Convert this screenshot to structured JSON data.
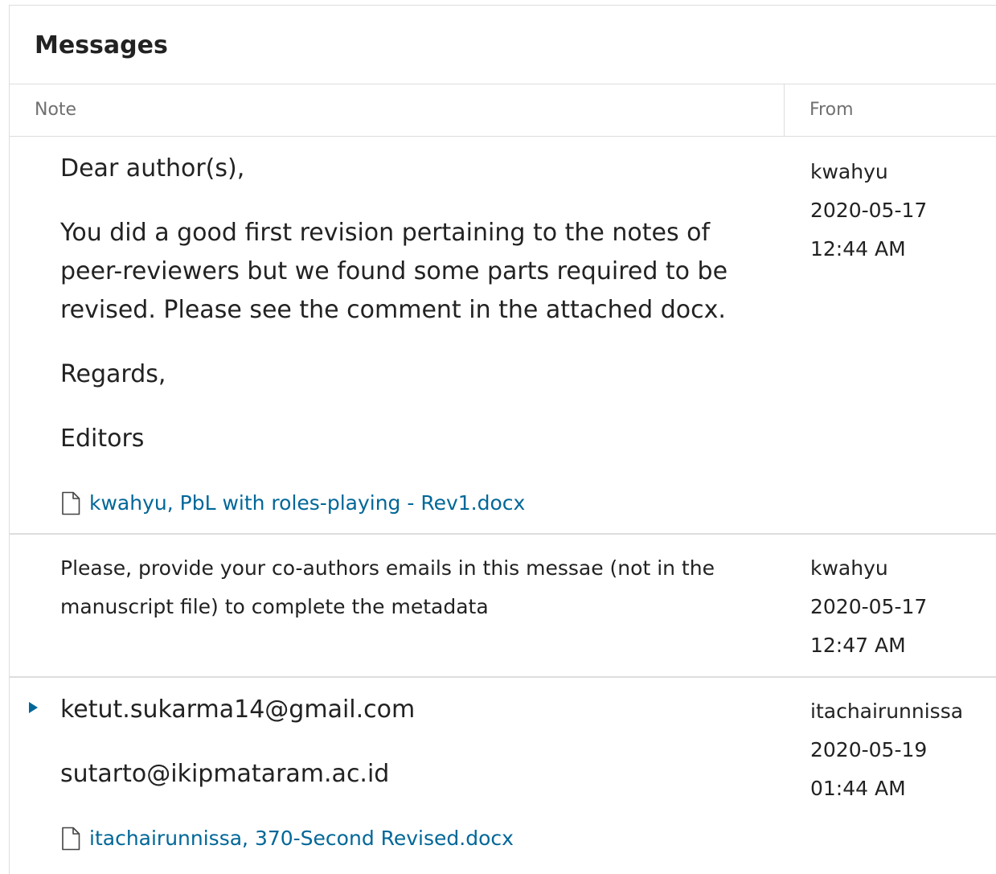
{
  "panel": {
    "title": "Messages"
  },
  "columns": {
    "note": "Note",
    "from": "From"
  },
  "messages": [
    {
      "paragraphs": [
        "Dear author(s),",
        "You did a good first revision pertaining to the notes of peer-reviewers but we found some parts required to be revised. Please see the comment in the attached docx.",
        "Regards,",
        "Editors"
      ],
      "attachment": "kwahyu, PbL with roles-playing - Rev1.docx",
      "from_user": "kwahyu",
      "date": "2020-05-17",
      "time": "12:44 AM"
    },
    {
      "paragraphs": [
        "Please, provide your co-authors emails in this messae (not in the manuscript file) to complete the metadata"
      ],
      "from_user": "kwahyu",
      "date": "2020-05-17",
      "time": "12:47 AM"
    },
    {
      "paragraphs": [
        "ketut.sukarma14@gmail.com",
        "sutarto@ikipmataram.ac.id"
      ],
      "attachment": "itachairunnissa, 370-Second Revised.docx",
      "from_user": "itachairunnissa",
      "date": "2020-05-19",
      "time": "01:44 AM"
    }
  ],
  "icons": {
    "file": "file-icon",
    "expand": "caret-right-icon"
  },
  "colors": {
    "link": "#006798",
    "border": "#dddddd",
    "header_text": "#707070",
    "body_text": "#222222"
  }
}
